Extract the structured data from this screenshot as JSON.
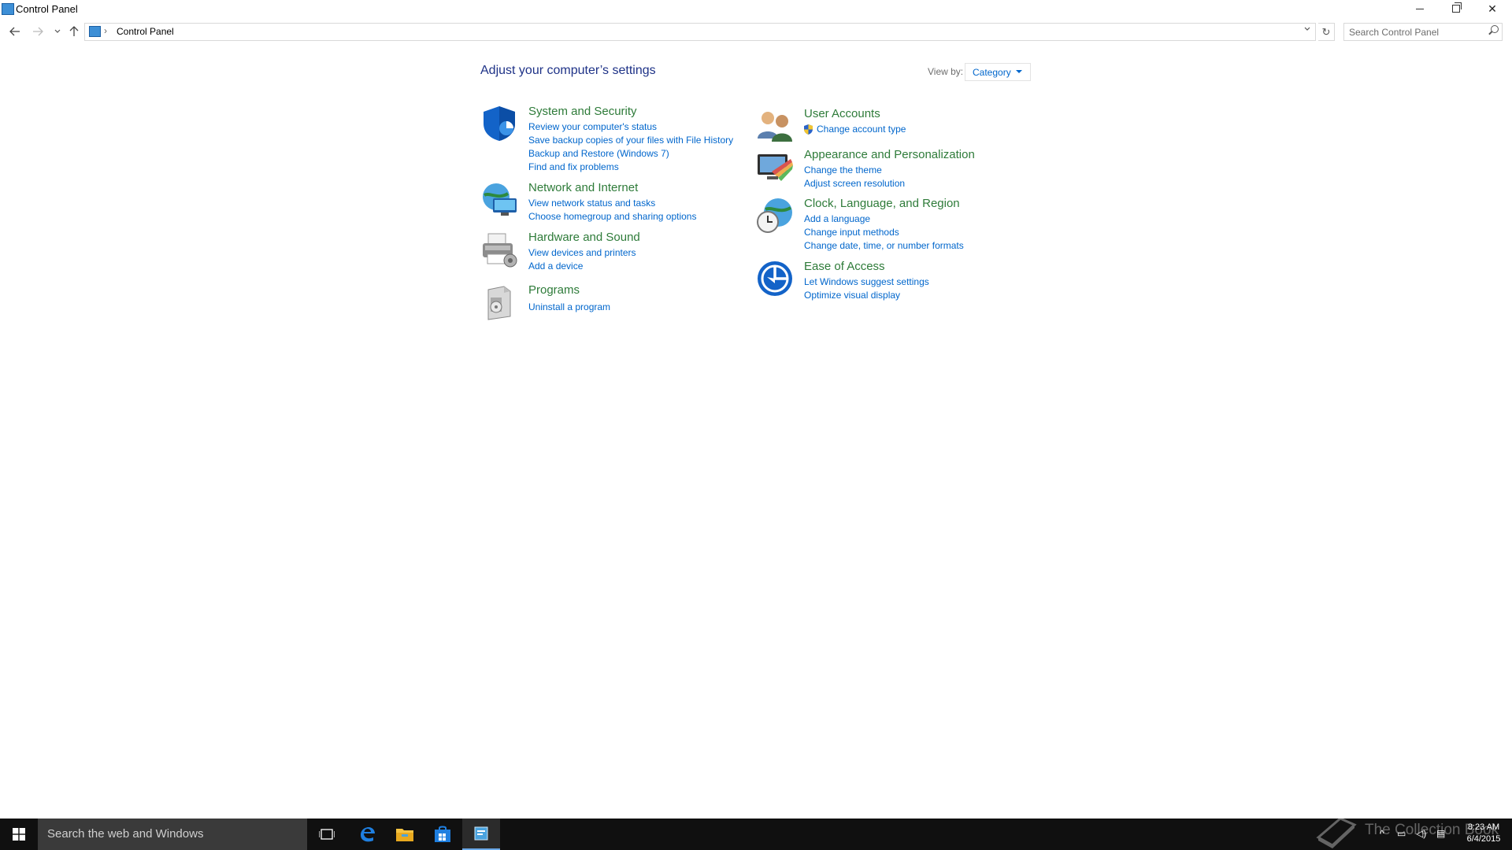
{
  "window": {
    "title": "Control Panel"
  },
  "address": {
    "crumb": "Control Panel",
    "search_placeholder": "Search Control Panel"
  },
  "content": {
    "heading": "Adjust your computer’s settings",
    "view_by_label": "View by:",
    "view_by_value": "Category",
    "categories": [
      {
        "title": "System and Security",
        "links": [
          "Review your computer's status",
          "Save backup copies of your files with File History",
          "Backup and Restore (Windows 7)",
          "Find and fix problems"
        ]
      },
      {
        "title": "Network and Internet",
        "links": [
          "View network status and tasks",
          "Choose homegroup and sharing options"
        ]
      },
      {
        "title": "Hardware and Sound",
        "links": [
          "View devices and printers",
          "Add a device"
        ]
      },
      {
        "title": "Programs",
        "links": [
          "Uninstall a program"
        ]
      },
      {
        "title": "User Accounts",
        "links": [
          "Change account type"
        ]
      },
      {
        "title": "Appearance and Personalization",
        "links": [
          "Change the theme",
          "Adjust screen resolution"
        ]
      },
      {
        "title": "Clock, Language, and Region",
        "links": [
          "Add a language",
          "Change input methods",
          "Change date, time, or number formats"
        ]
      },
      {
        "title": "Ease of Access",
        "links": [
          "Let Windows suggest settings",
          "Optimize visual display"
        ]
      }
    ]
  },
  "taskbar": {
    "search_text": "Search the web and Windows",
    "time": "8:23 AM",
    "date": "6/4/2015",
    "watermark": "The Collection Book"
  },
  "colors": {
    "category_title": "#2e7b39",
    "link": "#0066cc",
    "heading": "#1e3287",
    "taskbar": "#101010"
  }
}
